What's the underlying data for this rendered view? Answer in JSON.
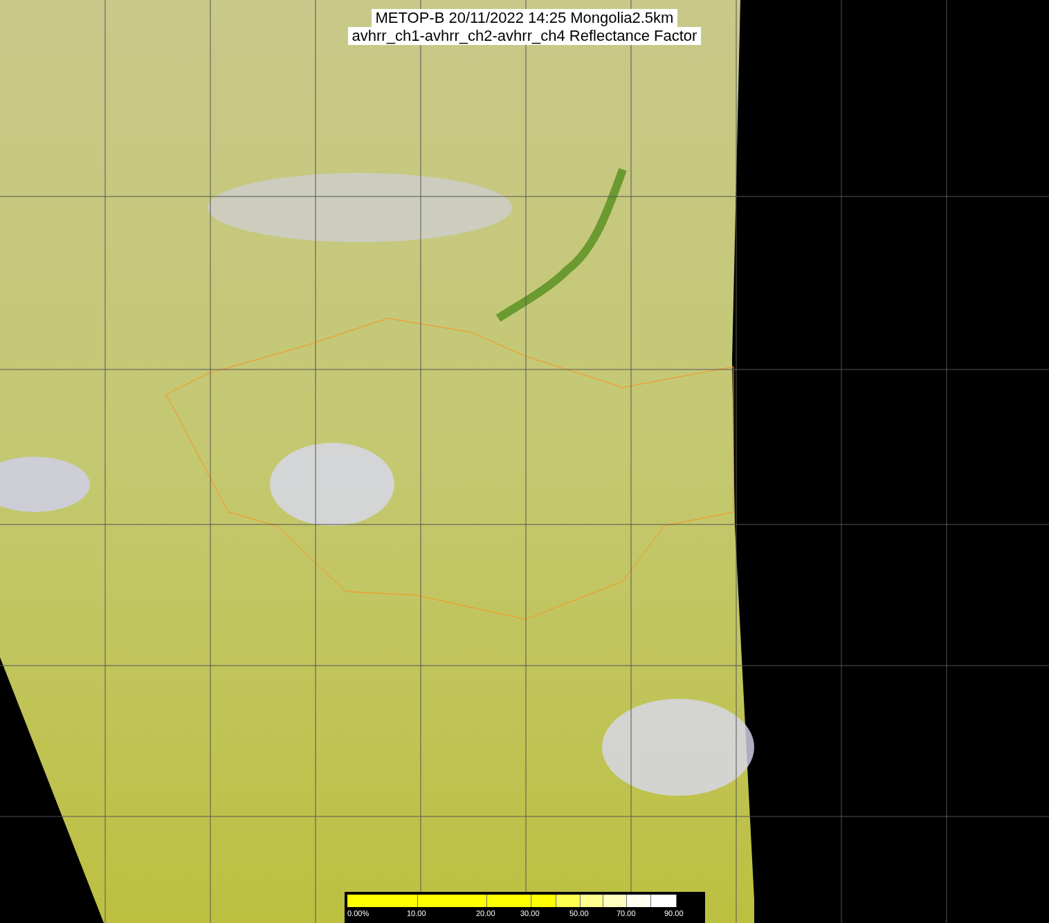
{
  "title": {
    "lines": [
      "METOP-B 20/11/2022 14:25 Mongolia2.5km",
      "avhrr_ch1-avhrr_ch2-avhrr_ch4 Reflectance Factor"
    ]
  },
  "colorbar": {
    "segments": [
      {
        "color": "#ffff00"
      },
      {
        "color": "#ffff00"
      },
      {
        "color": "#ffff00"
      },
      {
        "color": "#ffff00"
      },
      {
        "color": "#ffff50"
      },
      {
        "color": "#ffff90"
      },
      {
        "color": "#ffffc0"
      },
      {
        "color": "#fffff0"
      },
      {
        "color": "#ffffff"
      }
    ],
    "labels": [
      "0.00%",
      "10.00",
      "20.00",
      "30.00",
      "50.00",
      "70.00",
      "90.00"
    ]
  }
}
